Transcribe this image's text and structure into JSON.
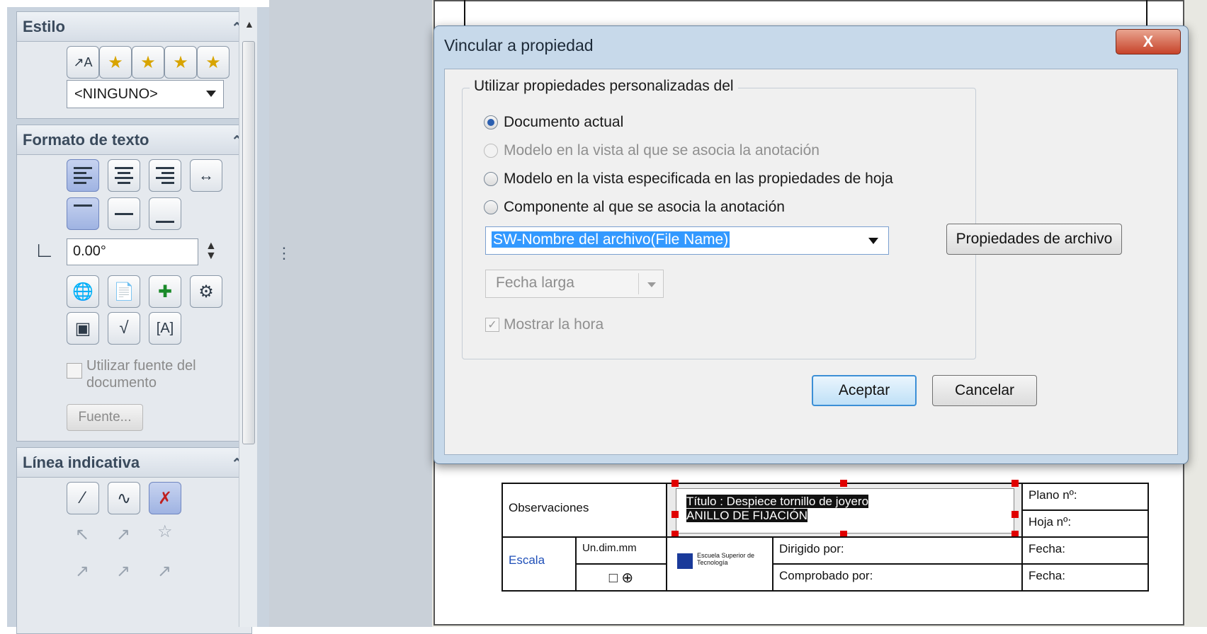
{
  "left_panel": {
    "style_group": {
      "title": "Estilo",
      "style_select_value": "<NINGUNO>"
    },
    "text_format_group": {
      "title": "Formato de texto",
      "angle_value": "0.00°",
      "use_doc_font_label": "Utilizar fuente del documento",
      "font_button_label": "Fuente..."
    },
    "leader_group": {
      "title": "Línea indicativa"
    }
  },
  "dialog": {
    "title": "Vincular a propiedad",
    "close_label": "X",
    "group_label": "Utilizar propiedades personalizadas del",
    "options": [
      {
        "label": "Documento actual",
        "checked": true,
        "enabled": true
      },
      {
        "label": "Modelo en la vista al que se asocia la anotación",
        "checked": false,
        "enabled": false
      },
      {
        "label": "Modelo en la vista especificada en las propiedades de hoja",
        "checked": false,
        "enabled": true
      },
      {
        "label": "Componente al que se asocia la anotación",
        "checked": false,
        "enabled": true
      }
    ],
    "property_select_value": "SW-Nombre del archivo(File Name)",
    "date_format_value": "Fecha larga",
    "show_time_label": "Mostrar la hora",
    "file_properties_button": "Propiedades de archivo",
    "ok_button": "Aceptar",
    "cancel_button": "Cancelar"
  },
  "title_block": {
    "observations": "Observaciones",
    "title_line1": "Título : Despiece tornillo de joyero",
    "title_line2": "ANILLO DE FIJACIÓN",
    "plan_no": "Plano nº:",
    "sheet_no": "Hoja nº:",
    "scale": "Escala",
    "units": "Un.dim.mm",
    "logo_text": "Escuela Superior de Tecnología",
    "directed_by": "Dirigido por:",
    "checked_by": "Comprobado por:",
    "date1": "Fecha:",
    "date2": "Fecha:"
  },
  "colors": {
    "dialog_frame": "#c7d9ea",
    "close_button": "#c7432a",
    "default_button_border": "#3c8fd6",
    "selection_highlight": "#3399ff",
    "scale_text": "#1f4fb8",
    "handle_red": "#e00000"
  }
}
